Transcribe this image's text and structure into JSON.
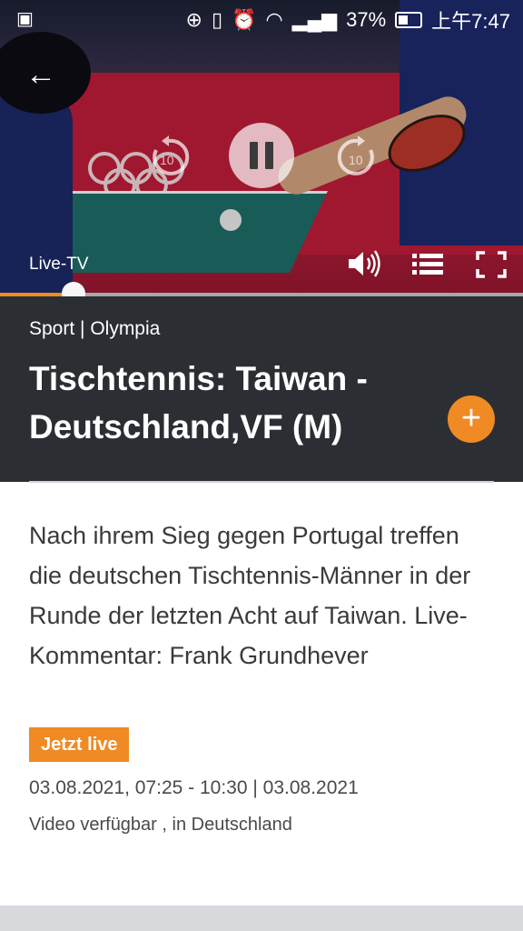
{
  "status_bar": {
    "battery": "37%",
    "time": "上午7:47"
  },
  "player": {
    "live_tv_label": "Live-TV",
    "progress_fraction": 0.14,
    "state": "playing"
  },
  "program": {
    "category": "Sport | Olympia",
    "title": "Tischtennis: Taiwan - Deutschland,VF (M)",
    "description": "Nach ihrem Sieg gegen Portugal treffen die deutschen Tischtennis-Männer in der Runde der letzten Acht auf Taiwan. Live-Kommentar: Frank Grundhever",
    "live_badge": "Jetzt live",
    "datetime": "03.08.2021, 07:25 - 10:30 | 03.08.2021",
    "availability": "Video verfügbar , in Deutschland"
  },
  "colors": {
    "accent": "#f08a24",
    "header_bg": "#2b2f33"
  },
  "icons": [
    "back-arrow-icon",
    "rewind-10-icon",
    "pause-icon",
    "forward-10-icon",
    "volume-icon",
    "list-icon",
    "fullscreen-icon",
    "add-icon"
  ]
}
